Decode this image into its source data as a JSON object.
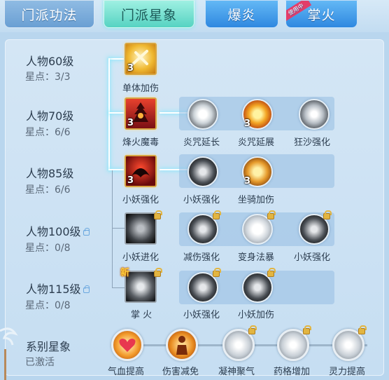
{
  "tabs": [
    {
      "label": "门派功法"
    },
    {
      "label": "门派星象"
    },
    {
      "label": "爆炎"
    },
    {
      "label": "掌火",
      "badge": "使用中"
    }
  ],
  "rows": [
    {
      "level": "人物60级",
      "stars": "星点：3/3",
      "locked": false
    },
    {
      "level": "人物70级",
      "stars": "星点：6/6",
      "locked": false
    },
    {
      "level": "人物85级",
      "stars": "星点：6/6",
      "locked": false
    },
    {
      "level": "人物100级",
      "stars": "星点：0/8",
      "locked": true
    },
    {
      "level": "人物115级",
      "stars": "星点：0/8",
      "locked": true
    }
  ],
  "skills": {
    "r60": {
      "name": "单体加伤",
      "count": "3"
    },
    "r70": {
      "name": "烽火魔毒",
      "count": "3",
      "subs": [
        {
          "name": "炎咒延长",
          "count": ""
        },
        {
          "name": "炎咒延展",
          "count": "3"
        },
        {
          "name": "狂沙强化",
          "count": ""
        }
      ]
    },
    "r85": {
      "name": "小妖强化",
      "count": "3",
      "subs": [
        {
          "name": "小妖强化",
          "count": ""
        },
        {
          "name": "坐骑加伤",
          "count": "3"
        }
      ]
    },
    "r100": {
      "name": "小妖进化",
      "count": "",
      "subs": [
        {
          "name": "减伤强化",
          "count": ""
        },
        {
          "name": "变身法暴",
          "count": ""
        },
        {
          "name": "小妖强化",
          "count": ""
        }
      ]
    },
    "r115": {
      "name": "掌 火",
      "count": "",
      "new": "新",
      "subs": [
        {
          "name": "小妖强化",
          "count": ""
        },
        {
          "name": "小妖加伤",
          "count": ""
        }
      ]
    }
  },
  "series": {
    "title": "系别星象",
    "status": "已激活",
    "nodes": [
      {
        "name": "气血提高"
      },
      {
        "name": "伤害减免"
      },
      {
        "name": "凝神聚气"
      },
      {
        "name": "药格增加"
      },
      {
        "name": "灵力提高"
      }
    ]
  },
  "colors": {
    "selected_tab": "#56d3c2",
    "tab_blue": "#2f88e0",
    "gold_frame": "#d8a642",
    "panel_bg": "#c6def2"
  }
}
